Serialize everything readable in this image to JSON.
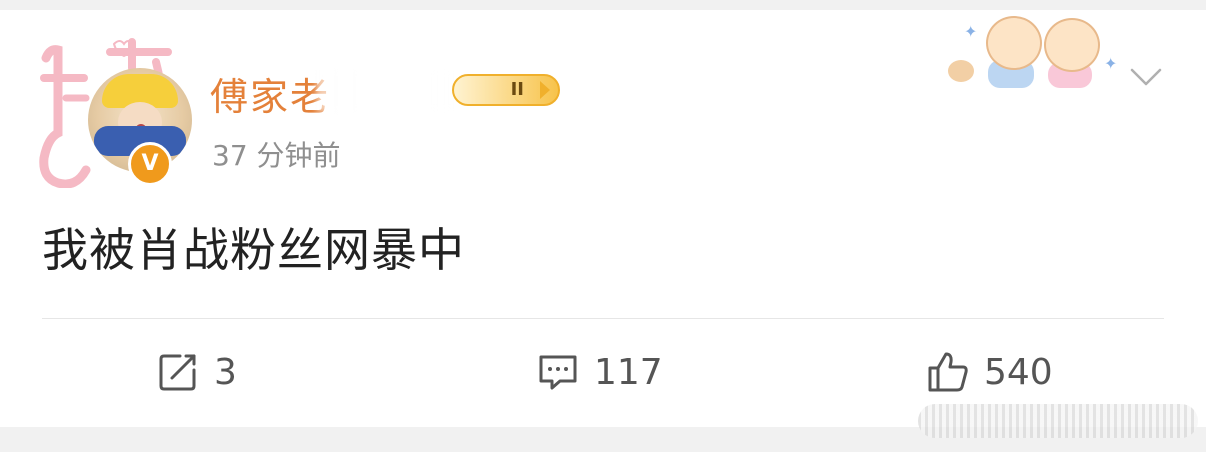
{
  "post": {
    "username": "傅家老",
    "member_badge": "II",
    "timestamp": "37 分钟前",
    "content": "我被肖战粉丝网暴中",
    "avatar_badge": "V"
  },
  "actions": {
    "repost_count": "3",
    "comment_count": "117",
    "like_count": "540"
  },
  "colors": {
    "username": "#e4813a",
    "timestamp": "#8f8f8f",
    "content": "#222222",
    "verified_badge": "#f09a1c",
    "icons": "#555555"
  },
  "icons": {
    "repost": "share-edit-icon",
    "comment": "comment-bubble-icon",
    "like": "thumbs-up-icon",
    "menu": "chevron-down-icon"
  }
}
